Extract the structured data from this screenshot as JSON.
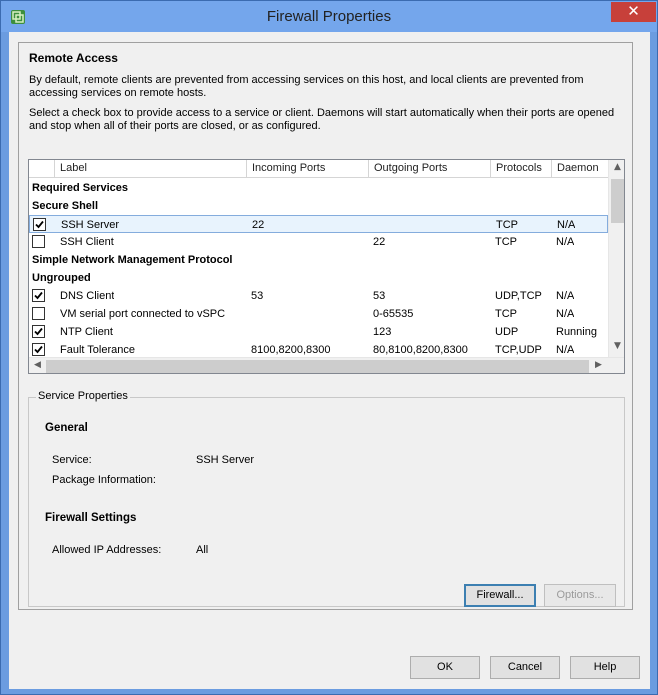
{
  "window": {
    "title": "Firewall Properties",
    "close_glyph": "✕"
  },
  "remote_access": {
    "heading": "Remote Access",
    "description": "By default, remote clients are prevented from accessing services on this host, and local clients are prevented from accessing services on remote hosts.",
    "instruction": "Select a check box to provide access to a service or client. Daemons will start automatically when their ports are opened and stop when all of their ports are closed, or as configured."
  },
  "grid": {
    "columns": [
      "Label",
      "Incoming Ports",
      "Outgoing Ports",
      "Protocols",
      "Daemon"
    ],
    "rows": [
      {
        "type": "group",
        "label": "Required Services"
      },
      {
        "type": "group",
        "label": "Secure Shell"
      },
      {
        "type": "item",
        "checked": true,
        "selected": true,
        "label": "SSH Server",
        "incoming": "22",
        "outgoing": "",
        "protocols": "TCP",
        "daemon": "N/A"
      },
      {
        "type": "item",
        "checked": false,
        "selected": false,
        "label": "SSH Client",
        "incoming": "",
        "outgoing": "22",
        "protocols": "TCP",
        "daemon": "N/A"
      },
      {
        "type": "group",
        "label": "Simple Network Management Protocol"
      },
      {
        "type": "group",
        "label": "Ungrouped"
      },
      {
        "type": "item",
        "checked": true,
        "selected": false,
        "label": "DNS Client",
        "incoming": "53",
        "outgoing": "53",
        "protocols": "UDP,TCP",
        "daemon": "N/A"
      },
      {
        "type": "item",
        "checked": false,
        "selected": false,
        "label": "VM serial port connected to vSPC",
        "incoming": "",
        "outgoing": "0-65535",
        "protocols": "TCP",
        "daemon": "N/A"
      },
      {
        "type": "item",
        "checked": true,
        "selected": false,
        "label": "NTP Client",
        "incoming": "",
        "outgoing": "123",
        "protocols": "UDP",
        "daemon": "Running"
      },
      {
        "type": "item",
        "checked": true,
        "selected": false,
        "label": "Fault Tolerance",
        "incoming": "8100,8200,8300",
        "outgoing": "80,8100,8200,8300",
        "protocols": "TCP,UDP",
        "daemon": "N/A"
      }
    ]
  },
  "service_properties": {
    "legend": "Service Properties",
    "general_heading": "General",
    "service_label": "Service:",
    "service_value": "SSH Server",
    "package_label": "Package Information:",
    "package_value": "",
    "firewall_heading": "Firewall Settings",
    "allowed_ip_label": "Allowed IP Addresses:",
    "allowed_ip_value": "All",
    "firewall_button": "Firewall...",
    "options_button": "Options..."
  },
  "dialog_buttons": {
    "ok": "OK",
    "cancel": "Cancel",
    "help": "Help"
  }
}
